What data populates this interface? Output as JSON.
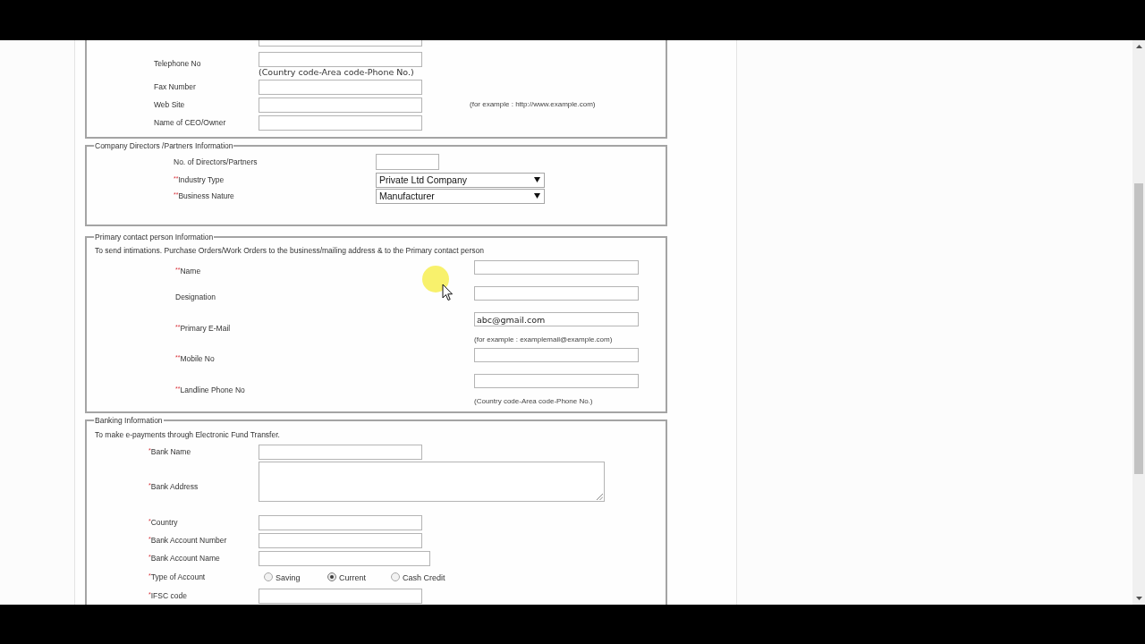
{
  "sections": [
    {
      "kind": "address",
      "fields": [
        {
          "kind": "clipped"
        },
        {
          "kind": "text",
          "label": "Telephone No",
          "hint": "(Country code-Area code-Phone No.)"
        },
        {
          "kind": "text",
          "label": "Fax Number"
        },
        {
          "kind": "text",
          "label": "Web Site",
          "note": "(for example : http://www.example.com)"
        },
        {
          "kind": "text",
          "label": "Name of CEO/Owner"
        }
      ]
    },
    {
      "kind": "directors",
      "legend": "Company Directors /Partners Information",
      "fields": [
        {
          "kind": "text",
          "label": "No. of Directors/Partners"
        },
        {
          "kind": "select",
          "required_mark": "**",
          "label": "Industry Type",
          "value": "Private Ltd Company"
        },
        {
          "kind": "select",
          "required_mark": "**",
          "label": "Business Nature",
          "value": "Manufacturer"
        }
      ]
    },
    {
      "kind": "contact",
      "legend": "Primary contact person Information",
      "description": "To send intimations. Purchase Orders/Work Orders to the business/mailing address & to the Primary contact person",
      "fields": [
        {
          "kind": "text",
          "required_mark": "**",
          "label": "Name"
        },
        {
          "kind": "text",
          "label": "Designation"
        },
        {
          "kind": "text",
          "required_mark": "**",
          "label": "Primary E-Mail",
          "value": "abc@gmail.com",
          "hint": "(for example : examplemail@example.com)"
        },
        {
          "kind": "text",
          "required_mark": "**",
          "label": "Mobile No"
        },
        {
          "kind": "text",
          "required_mark": "**",
          "label": "Landline Phone No",
          "hint": "(Country code-Area code-Phone No.)"
        }
      ]
    },
    {
      "kind": "banking",
      "legend": "Banking Information",
      "description": "To make e-payments through Electronic Fund Transfer.",
      "fields": [
        {
          "kind": "text",
          "required_mark": "*",
          "label": "Bank Name"
        },
        {
          "kind": "textarea",
          "required_mark": "*",
          "label": "Bank Address"
        },
        {
          "kind": "text",
          "required_mark": "*",
          "label": "Country"
        },
        {
          "kind": "text",
          "required_mark": "*",
          "label": "Bank Account Number"
        },
        {
          "kind": "text",
          "required_mark": "*",
          "label": "Bank Account Name"
        },
        {
          "kind": "radio",
          "required_mark": "*",
          "label": "Type of Account",
          "options": [
            {
              "label": "Saving",
              "selected": false
            },
            {
              "label": "Current",
              "selected": true
            },
            {
              "label": "Cash Credit",
              "selected": false
            }
          ]
        },
        {
          "kind": "text",
          "required_mark": "*",
          "label": "IFSC code"
        }
      ]
    }
  ]
}
